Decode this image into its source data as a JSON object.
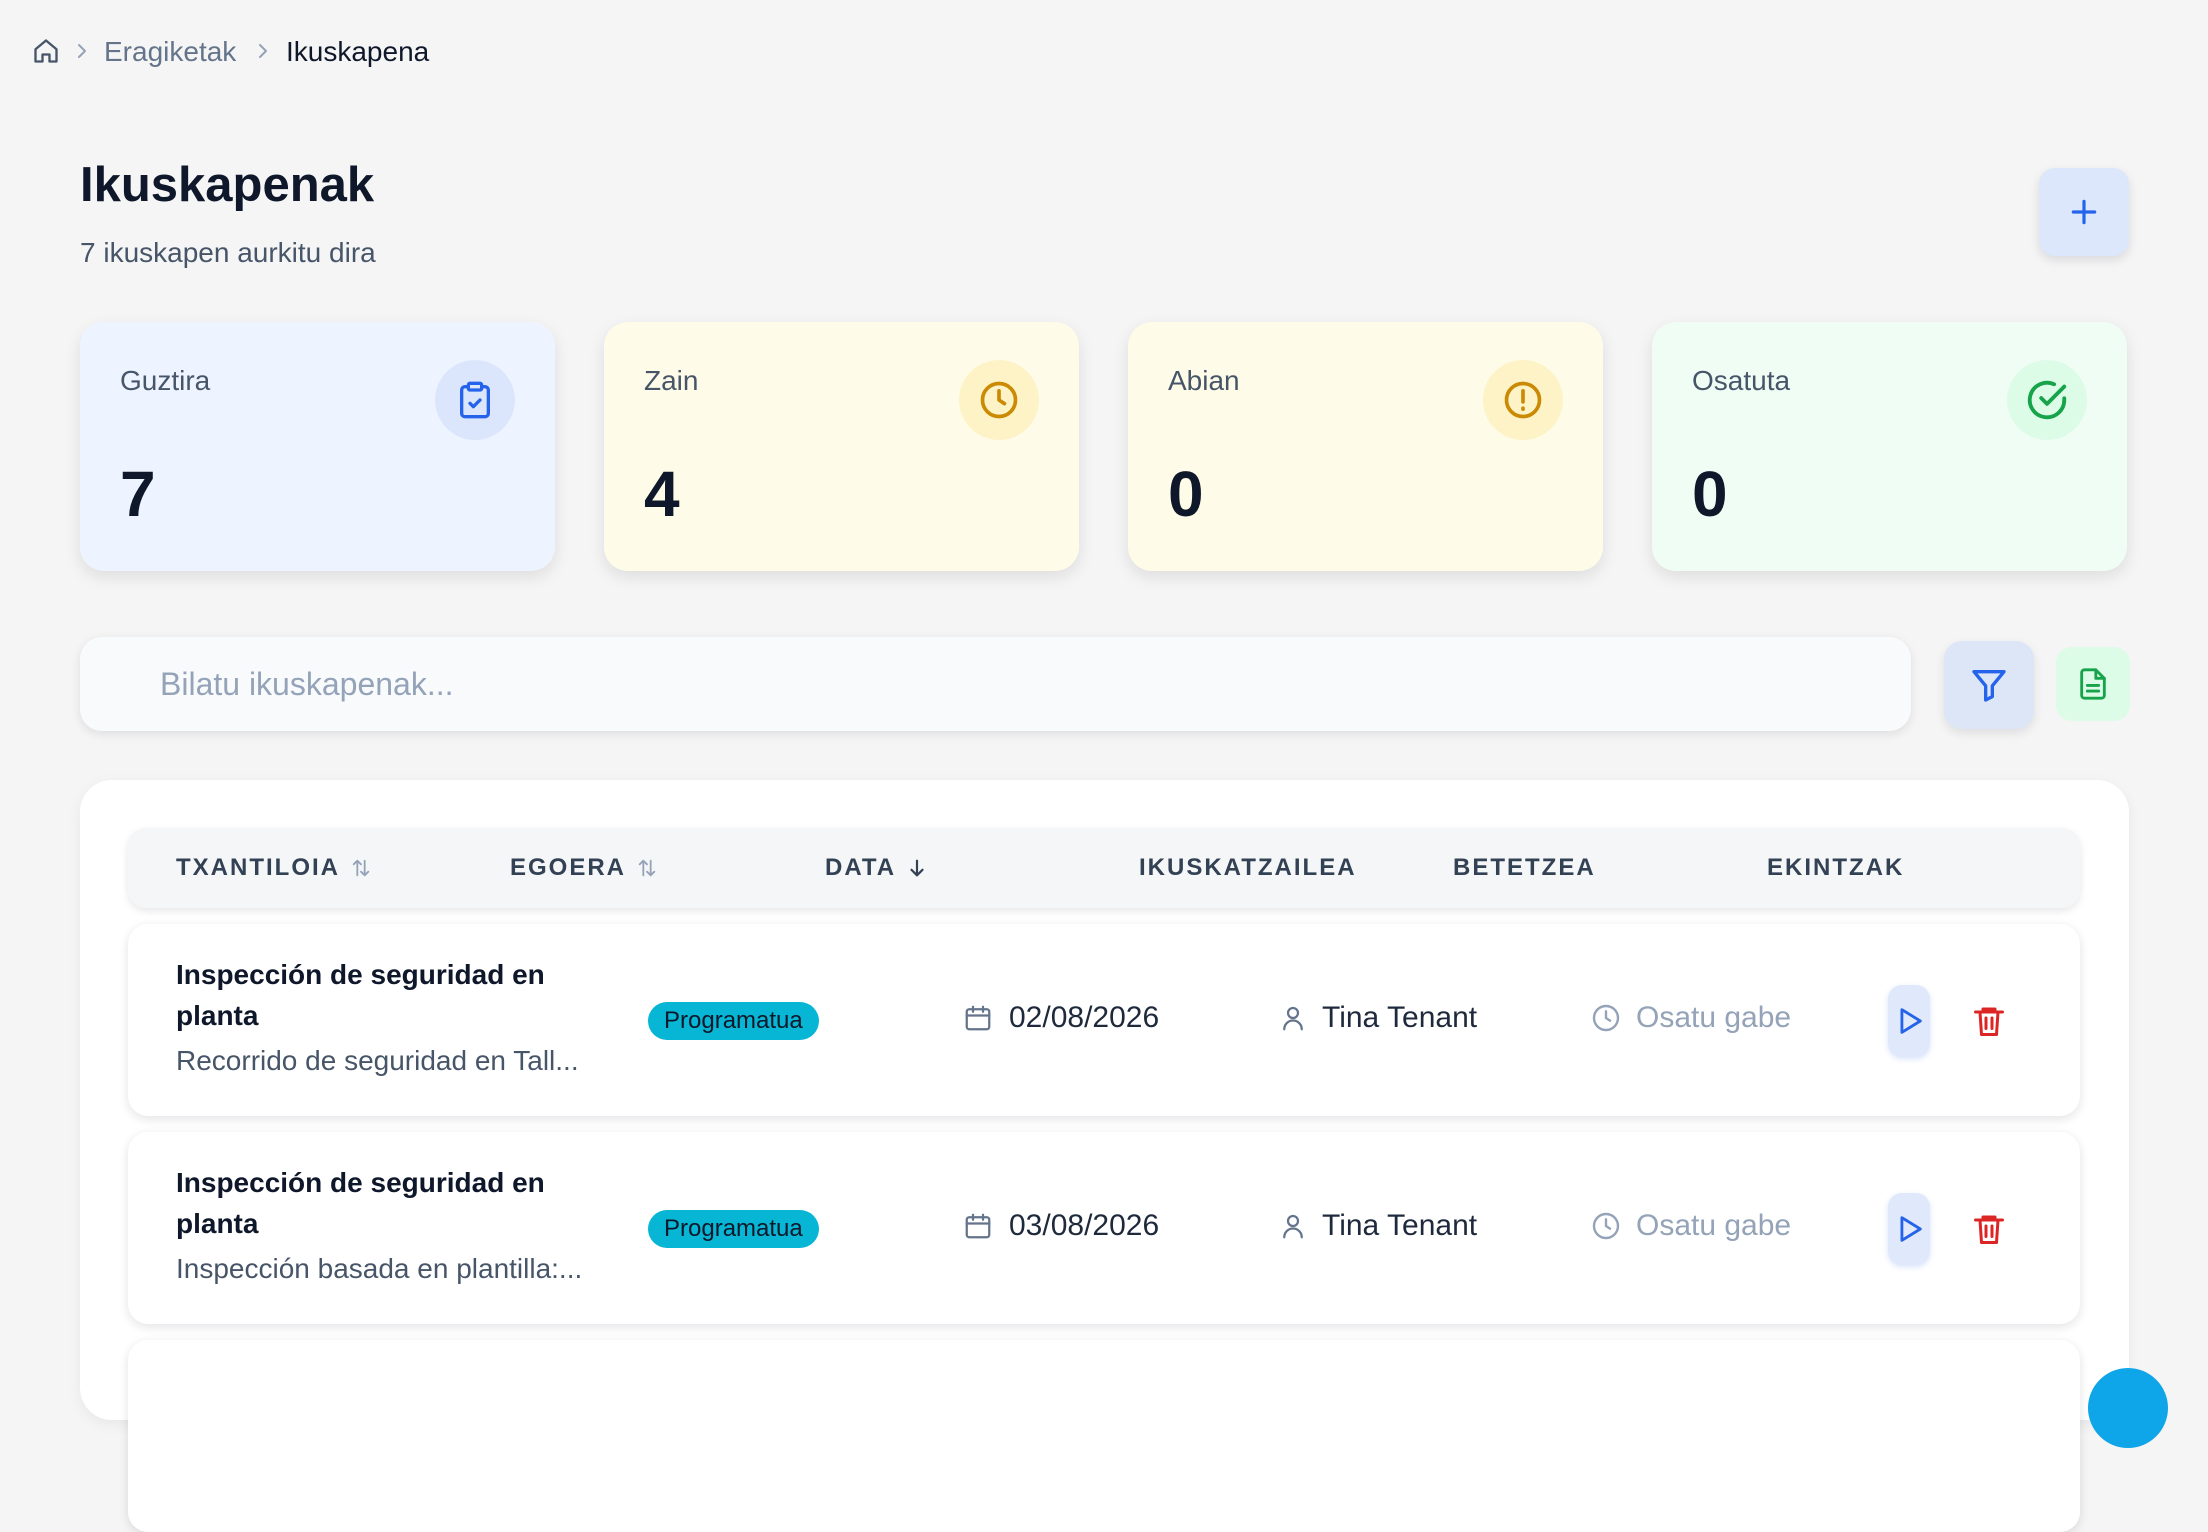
{
  "breadcrumb": {
    "home_icon": "home-icon",
    "items": [
      "Eragiketak",
      "Ikuskapena"
    ]
  },
  "header": {
    "title": "Ikuskapenak",
    "subtitle": "7 ikuskapen aurkitu dira",
    "add_icon": "plus-icon"
  },
  "stats": [
    {
      "label": "Guztira",
      "value": "7",
      "icon": "clipboard-check-icon",
      "bg": "#eef4ff",
      "icon_bg": "#dbe6fd",
      "icon_color": "#2563eb"
    },
    {
      "label": "Zain",
      "value": "4",
      "icon": "clock-icon",
      "bg": "#fefce8",
      "icon_bg": "#fef3c7",
      "icon_color": "#ca8a04"
    },
    {
      "label": "Abian",
      "value": "0",
      "icon": "alert-circle-icon",
      "bg": "#fefce8",
      "icon_bg": "#fef3c7",
      "icon_color": "#ca8a04"
    },
    {
      "label": "Osatuta",
      "value": "0",
      "icon": "check-circle-icon",
      "bg": "#f0fdf4",
      "icon_bg": "#dcfce7",
      "icon_color": "#16a34a"
    }
  ],
  "search": {
    "placeholder": "Bilatu ikuskapenak..."
  },
  "toolbar": {
    "filter_icon": "filter-icon",
    "export_icon": "file-text-icon"
  },
  "table": {
    "columns": [
      {
        "label": "TXANTILOIA",
        "sort": "sortable"
      },
      {
        "label": "EGOERA",
        "sort": "sortable"
      },
      {
        "label": "DATA",
        "sort": "descending"
      },
      {
        "label": "IKUSKATZAILEA",
        "sort": ""
      },
      {
        "label": "BETETZEA",
        "sort": ""
      },
      {
        "label": "EKINTZAK",
        "sort": ""
      }
    ],
    "rows": [
      {
        "title": "Inspección de seguridad en planta",
        "description": "Recorrido de seguridad en Tall...",
        "status": "Programatua",
        "date": "02/08/2026",
        "inspector": "Tina Tenant",
        "completion": "Osatu gabe"
      },
      {
        "title": "Inspección de seguridad en planta",
        "description": "Inspección basada en plantilla:...",
        "status": "Programatua",
        "date": "03/08/2026",
        "inspector": "Tina Tenant",
        "completion": "Osatu gabe"
      }
    ]
  },
  "colors": {
    "accent": "#2563eb",
    "status_badge": "#06b6d4",
    "danger": "#dc2626",
    "success": "#16a34a"
  }
}
